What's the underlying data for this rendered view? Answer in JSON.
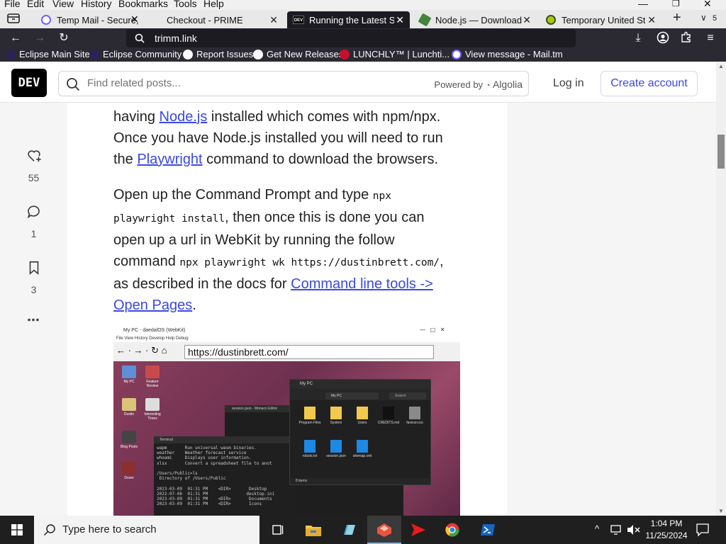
{
  "menubar": {
    "items": [
      "File",
      "Edit",
      "View",
      "History",
      "Bookmarks",
      "Tools",
      "Help"
    ]
  },
  "tabs": [
    {
      "label": "Temp Mail - Secure, Ins",
      "active": false,
      "icon": "temp-mail-icon"
    },
    {
      "label": "Checkout - PRIME",
      "active": false,
      "icon": ""
    },
    {
      "label": "Running the Latest Safa",
      "active": true,
      "icon": "dev-icon"
    },
    {
      "label": "Node.js — Download N",
      "active": false,
      "icon": "nodejs-icon"
    },
    {
      "label": "Temporary United State",
      "active": false,
      "icon": "temp-icon"
    }
  ],
  "tab_count_badge": "5",
  "navbar": {
    "url": "trimm.link"
  },
  "bookmarks": [
    {
      "label": "Eclipse Main Site",
      "color": "#2c2255"
    },
    {
      "label": "Eclipse Community",
      "color": "#2c2255"
    },
    {
      "label": "Report Issues",
      "color": "#fbfbfe"
    },
    {
      "label": "Get New Releases",
      "color": "#fbfbfe"
    },
    {
      "label": "LUNCHLY™ | Lunchti...",
      "color": "#c8102e"
    },
    {
      "label": "View message - Mail.tm",
      "color": "#7b5cff"
    }
  ],
  "dev": {
    "logo": "DEV",
    "search_placeholder": "Find related posts...",
    "powered_by": "Powered by",
    "algolia": "Algolia",
    "login": "Log in",
    "create_account": "Create account"
  },
  "rail": {
    "reactions": "55",
    "comments": "1",
    "bookmarks": "3",
    "more": "•••"
  },
  "article": {
    "p1_line1_pre": "having ",
    "p1_link1": "Node.js",
    "p1_line1_post": " installed which comes with npm/npx.",
    "p1_line2": "Once you have Node.js installed you will need to run",
    "p1_line3_pre": "the ",
    "p1_link2": "Playwright",
    "p1_line3_post": " command to download the browsers.",
    "p2_line1_pre": "Open up the Command Prompt and type ",
    "p2_code1a": "npx",
    "p2_code1b": "playwright install",
    "p2_line2_post": ", then once this is done you can",
    "p2_line3": "open up a url in WebKit by running the follow",
    "p2_line4_pre": "command ",
    "p2_code2": "npx playwright wk https://dustinbrett.com/",
    "p2_line4_post": ",",
    "p2_line5_pre": "as described in the docs for ",
    "p2_link3a": "Command line tools ->",
    "p2_link3b": "Open Pages",
    "p2_line6_post": "."
  },
  "screenshot": {
    "title": "My PC - daedalOS (WebKit)",
    "menu": "File   View   History   Develop   Help   Debug",
    "url": "https://dustinbrett.com/",
    "explorer_title": "My PC",
    "explorer_path": "My PC",
    "explorer_search": "Search",
    "explorer_status": "8 items",
    "desktop_icons": [
      "My PC",
      "Feature Review",
      "Dustin",
      "Interesting Times",
      "Blog Posts",
      "Doom"
    ],
    "explorer_items": [
      "Program Files",
      "System",
      "Users",
      "CREDITS.md",
      "favicon.ico",
      "robots.txt",
      "session.json",
      "sitemap.xml"
    ],
    "terminal_title": "Terminal",
    "editor_title": "session.json - Monaco Editor",
    "terminal_lines": [
      "wapm       Run universal wasm binaries.",
      "weather    Weather forecast service",
      "whoami     Displays user information.",
      "xlsx       Convert a spreadsheet file to anot",
      "",
      "/Users/Public>ls",
      " Directory of /Users/Public",
      "",
      "2023-03-09  01:31 PM    <DIR>       Desktop",
      "2022-07-06  01:31 PM               desktop.ini",
      "2023-03-09  01:31 PM    <DIR>       Documents",
      "2023-03-09  01:31 PM    <DIR>       Icons"
    ]
  },
  "taskbar": {
    "search_placeholder": "Type here to search",
    "time": "1:04 PM",
    "date": "11/25/2024"
  }
}
